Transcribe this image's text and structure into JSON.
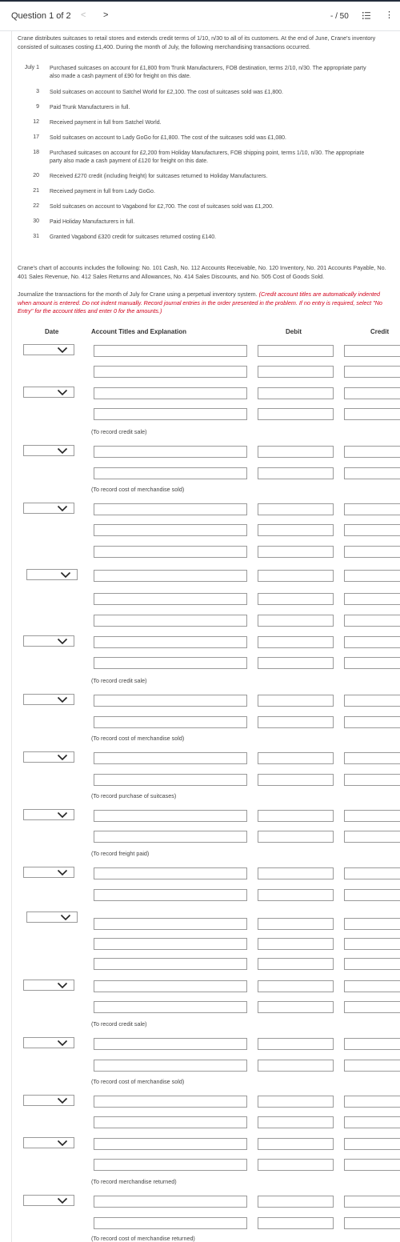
{
  "header": {
    "question_label": "Question 1 of 2",
    "prev_symbol": "<",
    "next_symbol": ">",
    "score": "- / 50",
    "more_symbol": "⋮"
  },
  "problem": {
    "intro": "Crane distributes suitcases to retail stores and extends credit terms of 1/10, n/30 to all of its customers. At the end of June, Crane's inventory consisted of suitcases costing £1,400. During the month of July, the following merchandising transactions occurred.",
    "transactions": [
      {
        "date": "July 1",
        "text": "Purchased suitcases on account for £1,800 from Trunk Manufacturers, FOB destination, terms 2/10, n/30. The appropriate party also made a cash payment of £90 for freight on this date."
      },
      {
        "date": "3",
        "text": "Sold suitcases on account to Satchel World for £2,100. The cost of suitcases sold was £1,800."
      },
      {
        "date": "9",
        "text": "Paid Trunk Manufacturers in full."
      },
      {
        "date": "12",
        "text": "Received payment in full from Satchel World."
      },
      {
        "date": "17",
        "text": "Sold suitcases on account to Lady GoGo for £1,800. The cost of the suitcases sold was £1,080."
      },
      {
        "date": "18",
        "text": "Purchased suitcases on account for £2,200 from Holiday Manufacturers, FOB shipping point, terms 1/10, n/30. The appropriate party also made a cash payment of £120 for freight on this date."
      },
      {
        "date": "20",
        "text": "Received £270 credit (including freight) for suitcases returned to Holiday Manufacturers."
      },
      {
        "date": "21",
        "text": "Received payment in full from Lady GoGo."
      },
      {
        "date": "22",
        "text": "Sold suitcases on account to Vagabond for £2,700. The cost of suitcases sold was £1,200."
      },
      {
        "date": "30",
        "text": "Paid Holiday Manufacturers in full."
      },
      {
        "date": "31",
        "text": "Granted Vagabond £320 credit for suitcases returned costing £140."
      }
    ],
    "chart_of_accounts": "Crane's chart of accounts includes the following: No. 101 Cash, No. 112 Accounts Receivable, No. 120 Inventory, No. 201 Accounts Payable, No. 401 Sales Revenue, No. 412 Sales Returns and Allowances, No. 414 Sales Discounts, and No. 505 Cost of Goods Sold.",
    "instruction": "Journalize the transactions for the month of July for Crane using a perpetual inventory system.",
    "instruction_note": "(Credit account titles are automatically indented when amount is entered. Do not indent manually. Record journal entries in the order presented in the problem. If no entry is required, select \"No Entry\" for the account titles and enter 0 for the amounts.)"
  },
  "journal": {
    "col_date": "Date",
    "col_account": "Account Titles and Explanation",
    "col_debit": "Debit",
    "col_credit": "Credit",
    "notes": [
      "(To record credit sale)",
      "(To record cost of merchandise sold)",
      "(To record credit sale)",
      "(To record cost of merchandise sold)",
      "(To record purchase of suitcases)",
      "(To record freight paid)",
      "(To record credit sale)",
      "(To record cost of merchandise sold)",
      "(To record merchandise returned)",
      "(To record cost of merchandise returned)"
    ]
  },
  "colors": {
    "instruction_note": "#d0021b",
    "topbar_border": "#232c3b",
    "input_border": "#9a9a9a"
  }
}
